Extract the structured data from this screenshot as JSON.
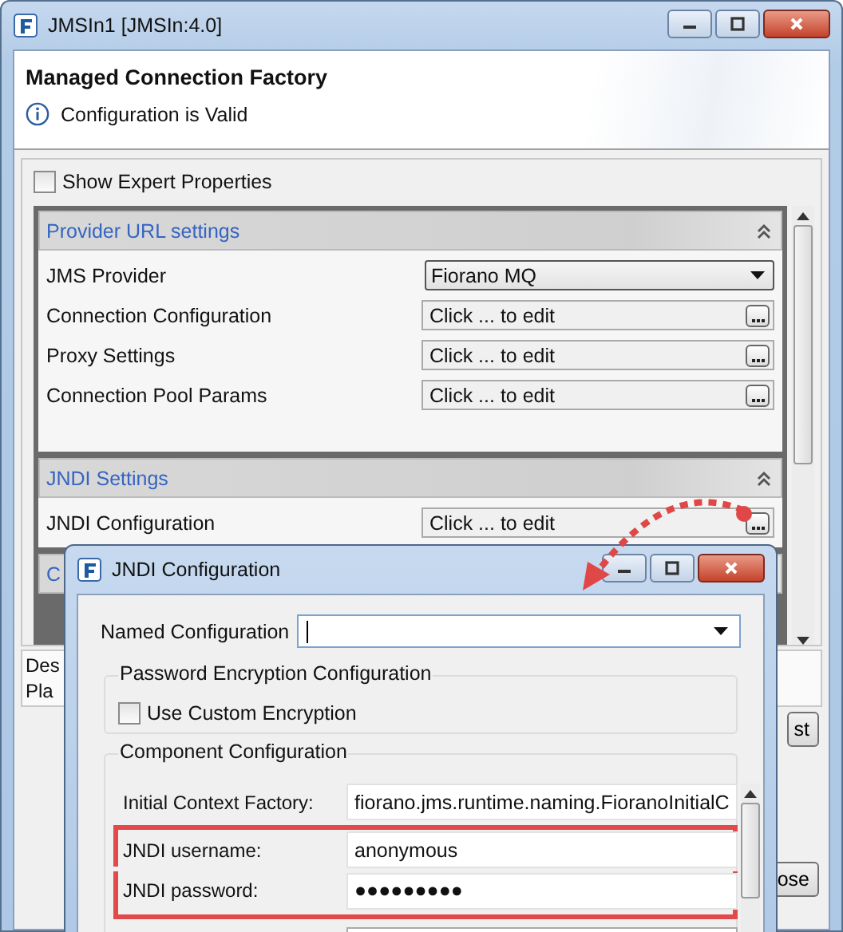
{
  "window": {
    "title": "JMSIn1 [JMSIn:4.0]"
  },
  "header": {
    "title": "Managed Connection Factory",
    "message": "Configuration is Valid"
  },
  "show_expert": {
    "label": "Show Expert Properties",
    "checked": false
  },
  "sections": [
    {
      "title": "Provider URL settings",
      "rows": [
        {
          "label": "JMS Provider",
          "kind": "dropdown",
          "value": "Fiorano MQ"
        },
        {
          "label": "Connection Configuration",
          "kind": "editor",
          "value": "Click ... to edit"
        },
        {
          "label": "Proxy Settings",
          "kind": "editor",
          "value": "Click ... to edit"
        },
        {
          "label": "Connection Pool Params",
          "kind": "editor",
          "value": "Click ... to edit"
        }
      ]
    },
    {
      "title": "JNDI Settings",
      "rows": [
        {
          "label": "JNDI Configuration",
          "kind": "editor",
          "value": "Click ... to edit"
        }
      ]
    },
    {
      "title": "C"
    }
  ],
  "description": [
    "Des",
    "Pla"
  ],
  "buttons": [
    "st",
    "ose"
  ],
  "dialog": {
    "title": "JNDI Configuration",
    "named_configuration": {
      "label": "Named Configuration"
    },
    "encryption": {
      "title": "Password Encryption Configuration",
      "checkbox": {
        "label": "Use Custom Encryption",
        "checked": false
      }
    },
    "component": {
      "title": "Component Configuration",
      "fields": [
        {
          "label": "Initial Context Factory:",
          "value": "fiorano.jms.runtime.naming.FioranoInitialC",
          "highlighted": false
        },
        {
          "label": "JNDI username:",
          "value": "anonymous",
          "highlighted": true
        },
        {
          "label": "JNDI password:",
          "value": "●●●●●●●●●",
          "highlighted": true
        }
      ]
    }
  }
}
